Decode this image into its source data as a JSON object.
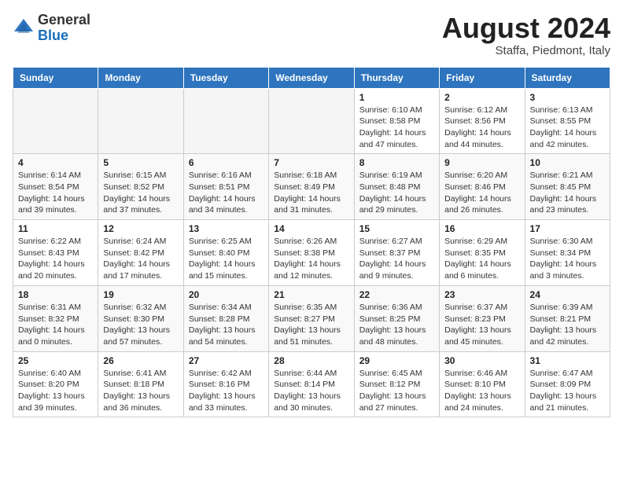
{
  "header": {
    "logo_general": "General",
    "logo_blue": "Blue",
    "month_year": "August 2024",
    "location": "Staffa, Piedmont, Italy"
  },
  "weekdays": [
    "Sunday",
    "Monday",
    "Tuesday",
    "Wednesday",
    "Thursday",
    "Friday",
    "Saturday"
  ],
  "weeks": [
    [
      {
        "day": "",
        "info": ""
      },
      {
        "day": "",
        "info": ""
      },
      {
        "day": "",
        "info": ""
      },
      {
        "day": "",
        "info": ""
      },
      {
        "day": "1",
        "info": "Sunrise: 6:10 AM\nSunset: 8:58 PM\nDaylight: 14 hours and 47 minutes."
      },
      {
        "day": "2",
        "info": "Sunrise: 6:12 AM\nSunset: 8:56 PM\nDaylight: 14 hours and 44 minutes."
      },
      {
        "day": "3",
        "info": "Sunrise: 6:13 AM\nSunset: 8:55 PM\nDaylight: 14 hours and 42 minutes."
      }
    ],
    [
      {
        "day": "4",
        "info": "Sunrise: 6:14 AM\nSunset: 8:54 PM\nDaylight: 14 hours and 39 minutes."
      },
      {
        "day": "5",
        "info": "Sunrise: 6:15 AM\nSunset: 8:52 PM\nDaylight: 14 hours and 37 minutes."
      },
      {
        "day": "6",
        "info": "Sunrise: 6:16 AM\nSunset: 8:51 PM\nDaylight: 14 hours and 34 minutes."
      },
      {
        "day": "7",
        "info": "Sunrise: 6:18 AM\nSunset: 8:49 PM\nDaylight: 14 hours and 31 minutes."
      },
      {
        "day": "8",
        "info": "Sunrise: 6:19 AM\nSunset: 8:48 PM\nDaylight: 14 hours and 29 minutes."
      },
      {
        "day": "9",
        "info": "Sunrise: 6:20 AM\nSunset: 8:46 PM\nDaylight: 14 hours and 26 minutes."
      },
      {
        "day": "10",
        "info": "Sunrise: 6:21 AM\nSunset: 8:45 PM\nDaylight: 14 hours and 23 minutes."
      }
    ],
    [
      {
        "day": "11",
        "info": "Sunrise: 6:22 AM\nSunset: 8:43 PM\nDaylight: 14 hours and 20 minutes."
      },
      {
        "day": "12",
        "info": "Sunrise: 6:24 AM\nSunset: 8:42 PM\nDaylight: 14 hours and 17 minutes."
      },
      {
        "day": "13",
        "info": "Sunrise: 6:25 AM\nSunset: 8:40 PM\nDaylight: 14 hours and 15 minutes."
      },
      {
        "day": "14",
        "info": "Sunrise: 6:26 AM\nSunset: 8:38 PM\nDaylight: 14 hours and 12 minutes."
      },
      {
        "day": "15",
        "info": "Sunrise: 6:27 AM\nSunset: 8:37 PM\nDaylight: 14 hours and 9 minutes."
      },
      {
        "day": "16",
        "info": "Sunrise: 6:29 AM\nSunset: 8:35 PM\nDaylight: 14 hours and 6 minutes."
      },
      {
        "day": "17",
        "info": "Sunrise: 6:30 AM\nSunset: 8:34 PM\nDaylight: 14 hours and 3 minutes."
      }
    ],
    [
      {
        "day": "18",
        "info": "Sunrise: 6:31 AM\nSunset: 8:32 PM\nDaylight: 14 hours and 0 minutes."
      },
      {
        "day": "19",
        "info": "Sunrise: 6:32 AM\nSunset: 8:30 PM\nDaylight: 13 hours and 57 minutes."
      },
      {
        "day": "20",
        "info": "Sunrise: 6:34 AM\nSunset: 8:28 PM\nDaylight: 13 hours and 54 minutes."
      },
      {
        "day": "21",
        "info": "Sunrise: 6:35 AM\nSunset: 8:27 PM\nDaylight: 13 hours and 51 minutes."
      },
      {
        "day": "22",
        "info": "Sunrise: 6:36 AM\nSunset: 8:25 PM\nDaylight: 13 hours and 48 minutes."
      },
      {
        "day": "23",
        "info": "Sunrise: 6:37 AM\nSunset: 8:23 PM\nDaylight: 13 hours and 45 minutes."
      },
      {
        "day": "24",
        "info": "Sunrise: 6:39 AM\nSunset: 8:21 PM\nDaylight: 13 hours and 42 minutes."
      }
    ],
    [
      {
        "day": "25",
        "info": "Sunrise: 6:40 AM\nSunset: 8:20 PM\nDaylight: 13 hours and 39 minutes."
      },
      {
        "day": "26",
        "info": "Sunrise: 6:41 AM\nSunset: 8:18 PM\nDaylight: 13 hours and 36 minutes."
      },
      {
        "day": "27",
        "info": "Sunrise: 6:42 AM\nSunset: 8:16 PM\nDaylight: 13 hours and 33 minutes."
      },
      {
        "day": "28",
        "info": "Sunrise: 6:44 AM\nSunset: 8:14 PM\nDaylight: 13 hours and 30 minutes."
      },
      {
        "day": "29",
        "info": "Sunrise: 6:45 AM\nSunset: 8:12 PM\nDaylight: 13 hours and 27 minutes."
      },
      {
        "day": "30",
        "info": "Sunrise: 6:46 AM\nSunset: 8:10 PM\nDaylight: 13 hours and 24 minutes."
      },
      {
        "day": "31",
        "info": "Sunrise: 6:47 AM\nSunset: 8:09 PM\nDaylight: 13 hours and 21 minutes."
      }
    ]
  ]
}
